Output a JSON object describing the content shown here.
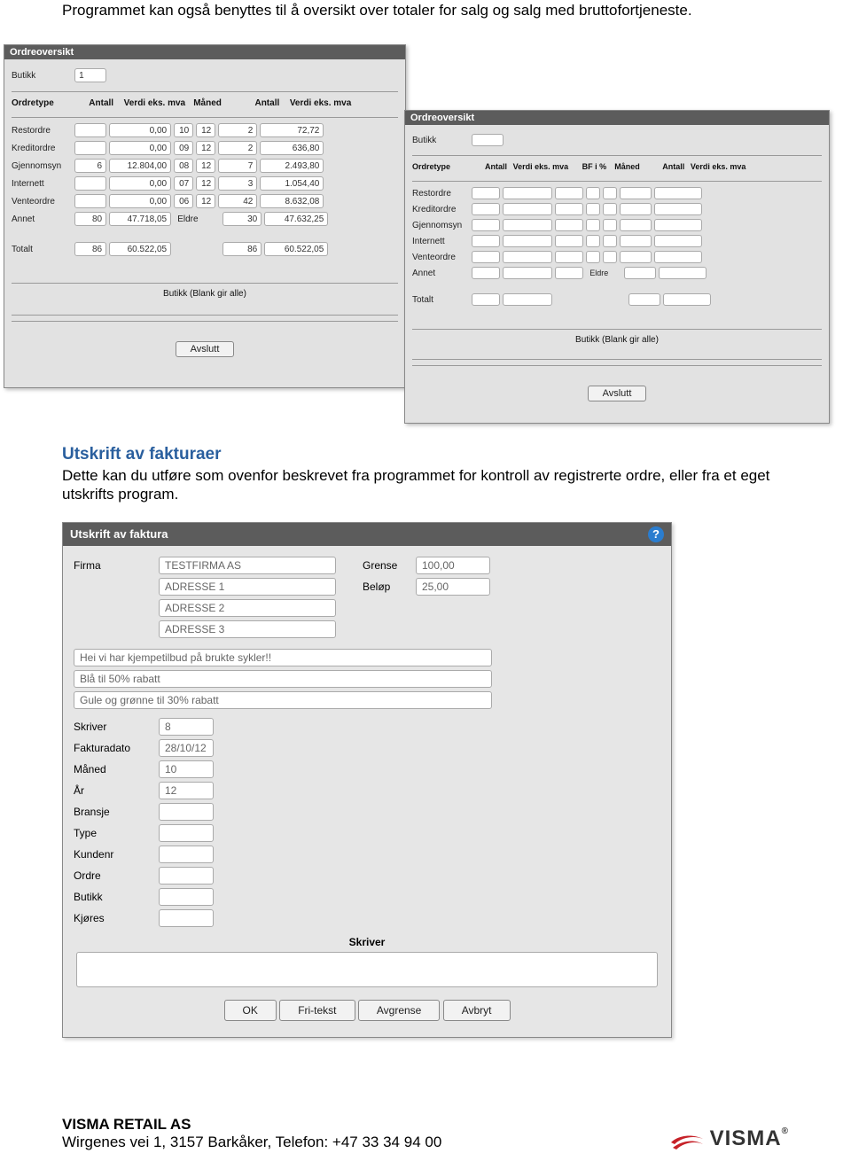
{
  "intro_text": "Programmet kan også benyttes til å oversikt over totaler for salg og salg med bruttofortjeneste.",
  "panel1": {
    "title": "Ordreoversikt",
    "butikk_label": "Butikk",
    "butikk_value": "1",
    "headers": {
      "ordretype": "Ordretype",
      "antall1": "Antall",
      "verdi1": "Verdi eks. mva",
      "maned": "Måned",
      "antall2": "Antall",
      "verdi2": "Verdi eks. mva"
    },
    "rows": [
      {
        "label": "Restordre",
        "a1": "",
        "v1": "0,00",
        "m1": "10",
        "m2": "12",
        "a2": "2",
        "v2": "72,72",
        "eldre": ""
      },
      {
        "label": "Kreditordre",
        "a1": "",
        "v1": "0,00",
        "m1": "09",
        "m2": "12",
        "a2": "2",
        "v2": "636,80",
        "eldre": ""
      },
      {
        "label": "Gjennomsyn",
        "a1": "6",
        "v1": "12.804,00",
        "m1": "08",
        "m2": "12",
        "a2": "7",
        "v2": "2.493,80",
        "eldre": ""
      },
      {
        "label": "Internett",
        "a1": "",
        "v1": "0,00",
        "m1": "07",
        "m2": "12",
        "a2": "3",
        "v2": "1.054,40",
        "eldre": ""
      },
      {
        "label": "Venteordre",
        "a1": "",
        "v1": "0,00",
        "m1": "06",
        "m2": "12",
        "a2": "42",
        "v2": "8.632,08",
        "eldre": ""
      },
      {
        "label": "Annet",
        "a1": "80",
        "v1": "47.718,05",
        "m1": "",
        "m2": "",
        "a2": "30",
        "v2": "47.632,25",
        "eldre": "Eldre"
      }
    ],
    "total_label": "Totalt",
    "total": {
      "a1": "86",
      "v1": "60.522,05",
      "a2": "86",
      "v2": "60.522,05"
    },
    "center_hint": "Butikk (Blank gir alle)",
    "avslutt": "Avslutt"
  },
  "panel2": {
    "title": "Ordreoversikt",
    "butikk_label": "Butikk",
    "headers": {
      "ordretype": "Ordretype",
      "antall1": "Antall",
      "verdi1": "Verdi eks. mva",
      "bf": "BF i %",
      "maned": "Måned",
      "antall2": "Antall",
      "verdi2": "Verdi eks. mva"
    },
    "row_labels": [
      "Restordre",
      "Kreditordre",
      "Gjennomsyn",
      "Internett",
      "Venteordre",
      "Annet"
    ],
    "eldre": "Eldre",
    "total_label": "Totalt",
    "center_hint": "Butikk (Blank gir alle)",
    "avslutt": "Avslutt"
  },
  "section": {
    "heading": "Utskrift av fakturaer",
    "text": "Dette kan du utføre som ovenfor beskrevet fra programmet for kontroll av registrerte ordre, eller fra et eget utskrifts program."
  },
  "panel3": {
    "title": "Utskrift av faktura",
    "firma_label": "Firma",
    "firma_values": [
      "TESTFIRMA AS",
      "ADRESSE 1",
      "ADRESSE 2",
      "ADRESSE 3"
    ],
    "grense_label": "Grense",
    "grense_value": "100,00",
    "belop_label": "Beløp",
    "belop_value": "25,00",
    "msg_lines": [
      "Hei vi har kjempetilbud på brukte sykler!!",
      "Blå til 50% rabatt",
      "Gule og grønne til 30% rabatt"
    ],
    "fields": [
      {
        "label": "Skriver",
        "value": "8"
      },
      {
        "label": "Fakturadato",
        "value": "28/10/12"
      },
      {
        "label": "Måned",
        "value": "10"
      },
      {
        "label": "År",
        "value": "12"
      },
      {
        "label": "Bransje",
        "value": ""
      },
      {
        "label": "Type",
        "value": ""
      },
      {
        "label": "Kundenr",
        "value": ""
      },
      {
        "label": "Ordre",
        "value": ""
      },
      {
        "label": "Butikk",
        "value": ""
      },
      {
        "label": "Kjøres",
        "value": ""
      }
    ],
    "skriver_hdr": "Skriver",
    "buttons": [
      "OK",
      "Fri-tekst",
      "Avgrense",
      "Avbryt"
    ]
  },
  "footer": {
    "company": "VISMA RETAIL AS",
    "address": "Wirgenes vei 1, 3157 Barkåker, Telefon: +47 33 34 94 00",
    "logo_text": "VISMA"
  }
}
